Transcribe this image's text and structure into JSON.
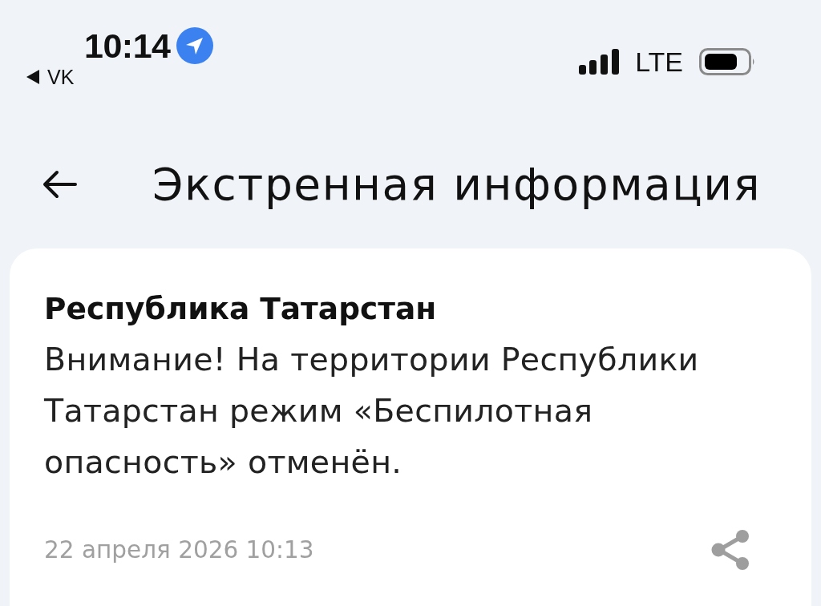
{
  "status_bar": {
    "time": "10:14",
    "back_app": "VK",
    "network": "LTE"
  },
  "header": {
    "title": "Экстренная информация"
  },
  "alert": {
    "region": "Республика Татарстан",
    "message": "Внимание! На территории Республики Татарстан режим «Беспилотная опасность» отменён.",
    "date": "22 апреля 2026 10:13"
  }
}
